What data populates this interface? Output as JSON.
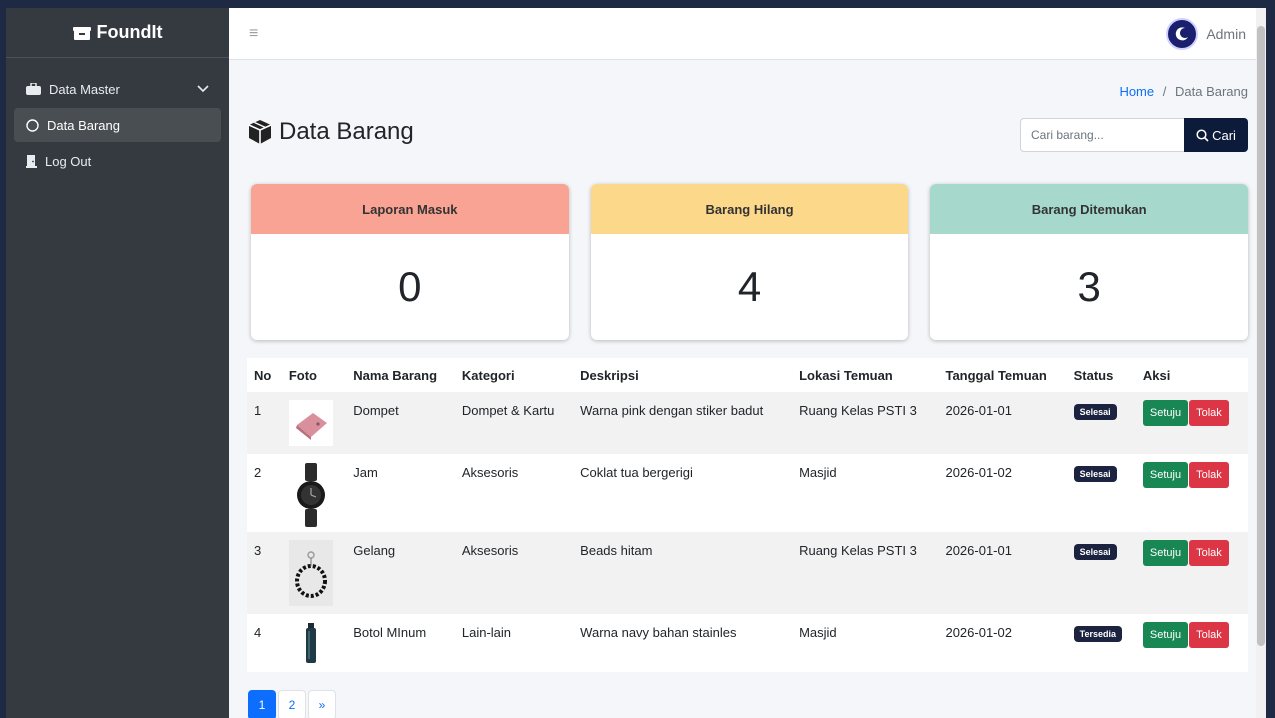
{
  "app": {
    "name": "FoundIt"
  },
  "sidebar": {
    "items": [
      {
        "label": "Data Master"
      },
      {
        "label": "Data Barang"
      },
      {
        "label": "Log Out"
      }
    ]
  },
  "topbar": {
    "menu_icon": "hamburger-icon",
    "user_label": "Admin"
  },
  "breadcrumb": {
    "home": "Home",
    "separator": "/",
    "current": "Data Barang"
  },
  "page": {
    "title": "Data Barang"
  },
  "search": {
    "placeholder": "Cari barang...",
    "button_label": "Cari"
  },
  "stats": [
    {
      "label": "Laporan Masuk",
      "value": "0",
      "color": "#f8a393"
    },
    {
      "label": "Barang Hilang",
      "value": "4",
      "color": "#fcd88a"
    },
    {
      "label": "Barang Ditemukan",
      "value": "3",
      "color": "#a6d9cc"
    }
  ],
  "table": {
    "headers": [
      "No",
      "Foto",
      "Nama Barang",
      "Kategori",
      "Deskripsi",
      "Lokasi Temuan",
      "Tanggal Temuan",
      "Status",
      "Aksi"
    ],
    "rows": [
      {
        "no": "1",
        "foto": "wallet-photo",
        "nama": "Dompet",
        "kategori": "Dompet & Kartu",
        "deskripsi": "Warna pink dengan stiker badut",
        "lokasi": "Ruang Kelas PSTI 3",
        "tanggal": "2026-01-01",
        "status": "Selesai",
        "approve": "Setuju",
        "reject": "Tolak"
      },
      {
        "no": "2",
        "foto": "watch-photo",
        "nama": "Jam",
        "kategori": "Aksesoris",
        "deskripsi": "Coklat tua bergerigi",
        "lokasi": "Masjid",
        "tanggal": "2026-01-02",
        "status": "Selesai",
        "approve": "Setuju",
        "reject": "Tolak"
      },
      {
        "no": "3",
        "foto": "bracelet-photo",
        "nama": "Gelang",
        "kategori": "Aksesoris",
        "deskripsi": "Beads hitam",
        "lokasi": "Ruang Kelas PSTI 3",
        "tanggal": "2026-01-01",
        "status": "Selesai",
        "approve": "Setuju",
        "reject": "Tolak"
      },
      {
        "no": "4",
        "foto": "bottle-photo",
        "nama": "Botol MInum",
        "kategori": "Lain-lain",
        "deskripsi": "Warna navy bahan stainles",
        "lokasi": "Masjid",
        "tanggal": "2026-01-02",
        "status": "Tersedia",
        "approve": "Setuju",
        "reject": "Tolak"
      }
    ]
  },
  "pagination": {
    "pages": [
      "1",
      "2"
    ],
    "next": "»",
    "current": "1"
  }
}
